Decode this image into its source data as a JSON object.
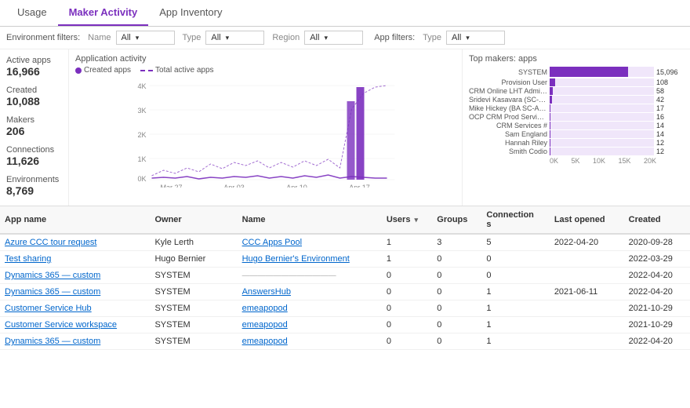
{
  "tabs": [
    {
      "label": "Usage",
      "active": false
    },
    {
      "label": "Maker Activity",
      "active": true
    },
    {
      "label": "App Inventory",
      "active": false
    }
  ],
  "filters": {
    "environment_label": "Environment filters:",
    "name_label": "Name",
    "name_value": "All",
    "type_label": "Type",
    "type_value": "All",
    "region_label": "Region",
    "region_value": "All",
    "app_label": "App filters:",
    "app_type_label": "Type",
    "app_type_value": "All"
  },
  "stats": [
    {
      "label": "Active apps",
      "value": "16,966"
    },
    {
      "label": "Created",
      "value": "10,088"
    },
    {
      "label": "Makers",
      "value": "206"
    },
    {
      "label": "Connections",
      "value": "11,626"
    },
    {
      "label": "Environments",
      "value": "8,769"
    }
  ],
  "activity_chart": {
    "title": "Application activity",
    "legend_created": "Created apps",
    "legend_total": "Total active apps",
    "y_labels": [
      "4K",
      "3K",
      "2K",
      "1K",
      "0K"
    ],
    "x_labels": [
      "Mar 27",
      "Apr 03",
      "Apr 10",
      "Apr 17"
    ]
  },
  "top_makers": {
    "title": "Top makers: apps",
    "entries": [
      {
        "name": "SYSTEM",
        "value": 15096,
        "display": "15,096"
      },
      {
        "name": "Provision User",
        "value": 108,
        "display": "108"
      },
      {
        "name": "CRM Online LHT Admin #",
        "value": 58,
        "display": "58"
      },
      {
        "name": "Sridevi Kasavara (SC-ACT)",
        "value": 42,
        "display": "42"
      },
      {
        "name": "Mike Hickey (BA SC-ACT)",
        "value": 17,
        "display": "17"
      },
      {
        "name": "OCP CRM Prod Service A...",
        "value": 16,
        "display": "16"
      },
      {
        "name": "CRM Services #",
        "value": 14,
        "display": "14"
      },
      {
        "name": "Sam England",
        "value": 14,
        "display": "14"
      },
      {
        "name": "Hannah Riley",
        "value": 12,
        "display": "12"
      },
      {
        "name": "Smith Codio",
        "value": 12,
        "display": "12"
      }
    ],
    "axis": [
      "0K",
      "5K",
      "10K",
      "15K",
      "20K"
    ],
    "max": 20000
  },
  "table": {
    "columns": [
      "App name",
      "Owner",
      "Name",
      "Users",
      "Groups",
      "Connections",
      "Last opened",
      "Created"
    ],
    "rows": [
      {
        "app_name": "Azure CCC tour request",
        "owner": "Kyle Lerth",
        "name": "CCC Apps Pool",
        "users": 1,
        "groups": 3,
        "connections": 5,
        "last_opened": "2022-04-20",
        "created": "2020-09-28"
      },
      {
        "app_name": "Test sharing",
        "owner": "Hugo Bernier",
        "name": "Hugo Bernier's Environment",
        "users": 1,
        "groups": 0,
        "connections": 0,
        "last_opened": "",
        "created": "2022-03-29"
      },
      {
        "app_name": "Dynamics 365 — custom",
        "owner": "SYSTEM",
        "name": "————————————",
        "users": 0,
        "groups": 0,
        "connections": 0,
        "last_opened": "",
        "created": "2022-04-20"
      },
      {
        "app_name": "Dynamics 365 — custom",
        "owner": "SYSTEM",
        "name": "AnswersHub",
        "users": 0,
        "groups": 0,
        "connections": 1,
        "last_opened": "2021-06-11",
        "created": "2022-04-20"
      },
      {
        "app_name": "Customer Service Hub",
        "owner": "SYSTEM",
        "name": "emeapopod",
        "users": 0,
        "groups": 0,
        "connections": 1,
        "last_opened": "",
        "created": "2021-10-29"
      },
      {
        "app_name": "Customer Service workspace",
        "owner": "SYSTEM",
        "name": "emeapopod",
        "users": 0,
        "groups": 0,
        "connections": 1,
        "last_opened": "",
        "created": "2021-10-29"
      },
      {
        "app_name": "Dynamics 365 — custom",
        "owner": "SYSTEM",
        "name": "emeapopod",
        "users": 0,
        "groups": 0,
        "connections": 1,
        "last_opened": "",
        "created": "2022-04-20"
      }
    ]
  }
}
